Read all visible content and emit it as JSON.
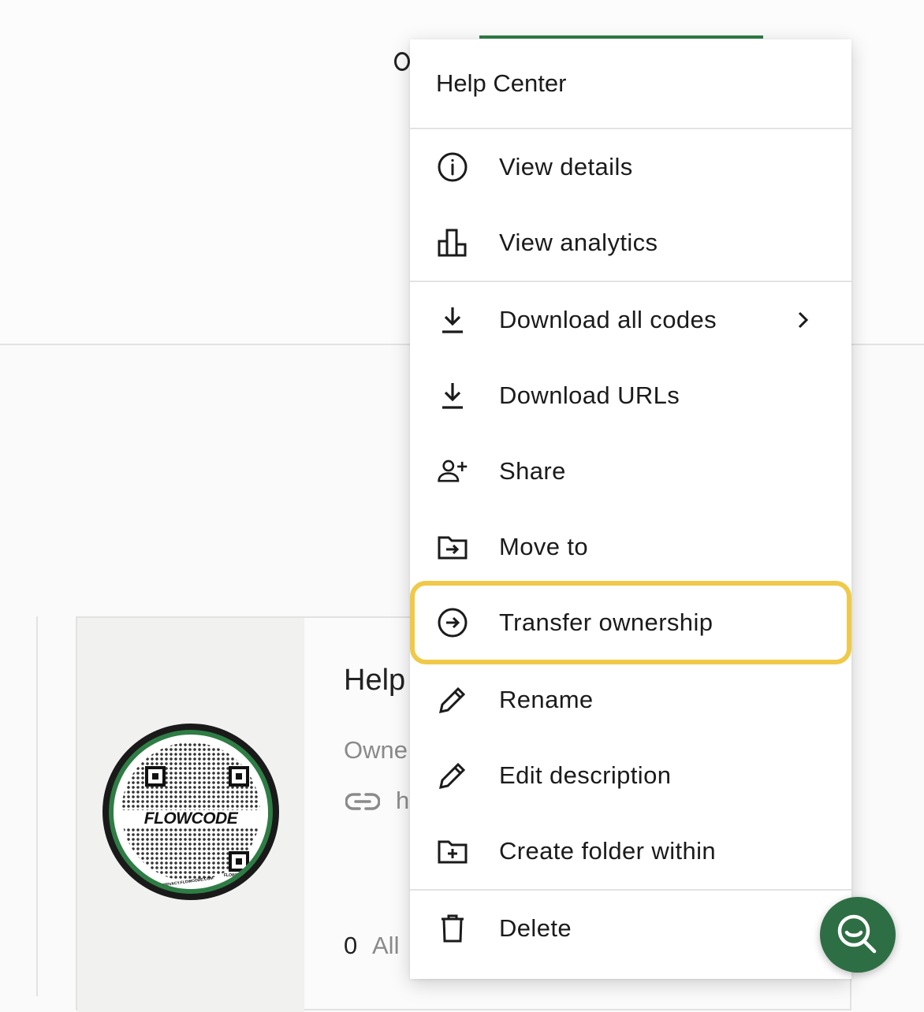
{
  "menu": {
    "header": "Help Center",
    "items": [
      {
        "label": "View details",
        "icon": "info-icon"
      },
      {
        "label": "View analytics",
        "icon": "bar-chart-icon"
      },
      {
        "label": "Download all codes",
        "icon": "download-icon",
        "has_submenu": true
      },
      {
        "label": "Download URLs",
        "icon": "download-icon"
      },
      {
        "label": "Share",
        "icon": "person-add-icon"
      },
      {
        "label": "Move to",
        "icon": "folder-move-icon"
      },
      {
        "label": "Transfer ownership",
        "icon": "arrow-circle-right-icon",
        "highlighted": true
      },
      {
        "label": "Rename",
        "icon": "pencil-icon"
      },
      {
        "label": "Edit description",
        "icon": "pencil-icon"
      },
      {
        "label": "Create folder within",
        "icon": "folder-add-icon"
      },
      {
        "label": "Delete",
        "icon": "trash-icon"
      }
    ]
  },
  "card": {
    "title": "Help",
    "owner": "Owne",
    "link": "h",
    "count": "0",
    "count_label": "All",
    "qr_brand": "FLOWCODE",
    "qr_footer": "PRIVACY.FLOWCODE.COM",
    "qr_corner": "FLOWCODE"
  },
  "colors": {
    "accent": "#2e7d45",
    "highlight": "#f0c948",
    "fab": "#2e6e44"
  },
  "fab": {
    "icon": "search-icon"
  }
}
